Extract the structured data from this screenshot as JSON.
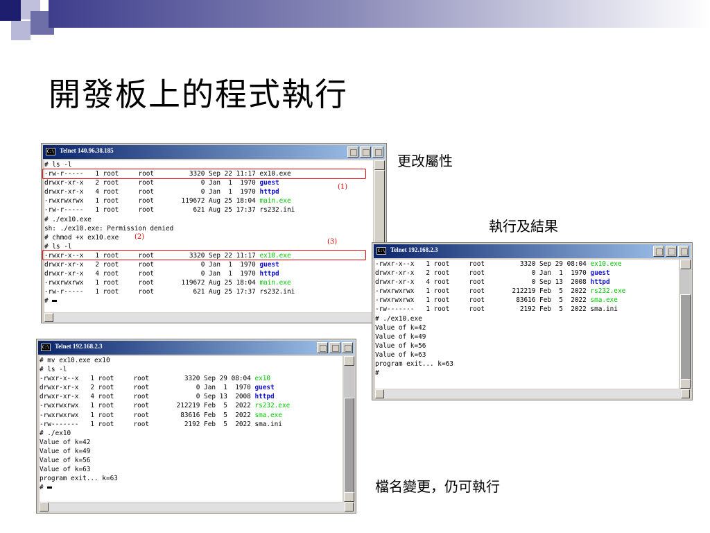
{
  "slide": {
    "title": "開發板上的程式執行",
    "notes": {
      "chmod": "更改屬性",
      "execute": "執行及結果",
      "rename": "檔名變更，仍可執行"
    },
    "markers": [
      "(1)",
      "(2)",
      "(3)"
    ],
    "colors": {
      "accent": "#3d3d8c",
      "highlight": "#e00000",
      "green": "#00c800",
      "blue": "#1010d0"
    }
  },
  "windows": {
    "w1": {
      "title": "Telnet 140.96.38.185",
      "icon": "console-icon",
      "lines": [
        [
          {
            "t": "# ls -l"
          }
        ],
        [
          {
            "t": "-rw-r-----   1 root     root         3320 Sep 22 11:17 ex10.exe"
          }
        ],
        [
          {
            "t": "drwxr-xr-x   2 root     root            0 Jan  1  1970 "
          },
          {
            "t": "guest",
            "c": "blue"
          }
        ],
        [
          {
            "t": "drwxr-xr-x   4 root     root            0 Jan  1  1970 "
          },
          {
            "t": "httpd",
            "c": "blue"
          }
        ],
        [
          {
            "t": "-rwxrwxrwx   1 root     root       119672 Aug 25 18:04 "
          },
          {
            "t": "main.exe",
            "c": "green"
          }
        ],
        [
          {
            "t": "-rw-r-----   1 root     root          621 Aug 25 17:37 rs232.ini"
          }
        ],
        [
          {
            "t": "# ./ex10.exe"
          }
        ],
        [
          {
            "t": "sh: ./ex10.exe: Permission denied"
          }
        ],
        [
          {
            "t": "# chmod +x ex10.exe"
          }
        ],
        [
          {
            "t": "# ls -l"
          }
        ],
        [
          {
            "t": "-rwxr-x--x   1 root     root         3320 Sep 22 11:17 "
          },
          {
            "t": "ex10.exe",
            "c": "green"
          }
        ],
        [
          {
            "t": "drwxr-xr-x   2 root     root            0 Jan  1  1970 "
          },
          {
            "t": "guest",
            "c": "blue"
          }
        ],
        [
          {
            "t": "drwxr-xr-x   4 root     root            0 Jan  1  1970 "
          },
          {
            "t": "httpd",
            "c": "blue"
          }
        ],
        [
          {
            "t": "-rwxrwxrwx   1 root     root       119672 Aug 25 18:04 "
          },
          {
            "t": "main.exe",
            "c": "green"
          }
        ],
        [
          {
            "t": "-rw-r-----   1 root     root          621 Aug 25 17:37 rs232.ini"
          }
        ],
        [
          {
            "t": "# "
          },
          {
            "cursor": true
          }
        ]
      ]
    },
    "w2": {
      "title": "Telnet 192.168.2.3",
      "icon": "console-icon",
      "lines": [
        [
          {
            "t": "-rwxr-x--x   1 root     root         3320 Sep 29 08:04 "
          },
          {
            "t": "ex10.exe",
            "c": "green"
          }
        ],
        [
          {
            "t": "drwxr-xr-x   2 root     root            0 Jan  1  1970 "
          },
          {
            "t": "guest",
            "c": "blue"
          }
        ],
        [
          {
            "t": "drwxr-xr-x   4 root     root            0 Sep 13  2008 "
          },
          {
            "t": "httpd",
            "c": "blue"
          }
        ],
        [
          {
            "t": "-rwxrwxrwx   1 root     root       212219 Feb  5  2022 "
          },
          {
            "t": "rs232.exe",
            "c": "green"
          }
        ],
        [
          {
            "t": "-rwxrwxrwx   1 root     root        83616 Feb  5  2022 "
          },
          {
            "t": "sma.exe",
            "c": "green"
          }
        ],
        [
          {
            "t": "-rw-------   1 root     root         2192 Feb  5  2022 sma.ini"
          }
        ],
        [
          {
            "t": "# ./ex10.exe"
          }
        ],
        [
          {
            "t": "Value of k=42"
          }
        ],
        [
          {
            "t": "Value of k=49"
          }
        ],
        [
          {
            "t": "Value of k=56"
          }
        ],
        [
          {
            "t": "Value of k=63"
          }
        ],
        [
          {
            "t": "program exit... k=63"
          }
        ],
        [
          {
            "t": "#"
          }
        ]
      ]
    },
    "w3": {
      "title": "Telnet 192.168.2.3",
      "icon": "console-icon",
      "lines": [
        [
          {
            "t": "# mv ex10.exe ex10"
          }
        ],
        [
          {
            "t": "# ls -l"
          }
        ],
        [
          {
            "t": "-rwxr-x--x   1 root     root         3320 Sep 29 08:04 "
          },
          {
            "t": "ex10",
            "c": "green"
          }
        ],
        [
          {
            "t": "drwxr-xr-x   2 root     root            0 Jan  1  1970 "
          },
          {
            "t": "guest",
            "c": "blue"
          }
        ],
        [
          {
            "t": "drwxr-xr-x   4 root     root            0 Sep 13  2008 "
          },
          {
            "t": "httpd",
            "c": "blue"
          }
        ],
        [
          {
            "t": "-rwxrwxrwx   1 root     root       212219 Feb  5  2022 "
          },
          {
            "t": "rs232.exe",
            "c": "green"
          }
        ],
        [
          {
            "t": "-rwxrwxrwx   1 root     root        83616 Feb  5  2022 "
          },
          {
            "t": "sma.exe",
            "c": "green"
          }
        ],
        [
          {
            "t": "-rw-------   1 root     root         2192 Feb  5  2022 sma.ini"
          }
        ],
        [
          {
            "t": "# ./ex10"
          }
        ],
        [
          {
            "t": "Value of k=42"
          }
        ],
        [
          {
            "t": "Value of k=49"
          }
        ],
        [
          {
            "t": "Value of k=56"
          }
        ],
        [
          {
            "t": "Value of k=63"
          }
        ],
        [
          {
            "t": "program exit... k=63"
          }
        ],
        [
          {
            "t": "# "
          },
          {
            "cursor": true
          }
        ]
      ]
    }
  }
}
